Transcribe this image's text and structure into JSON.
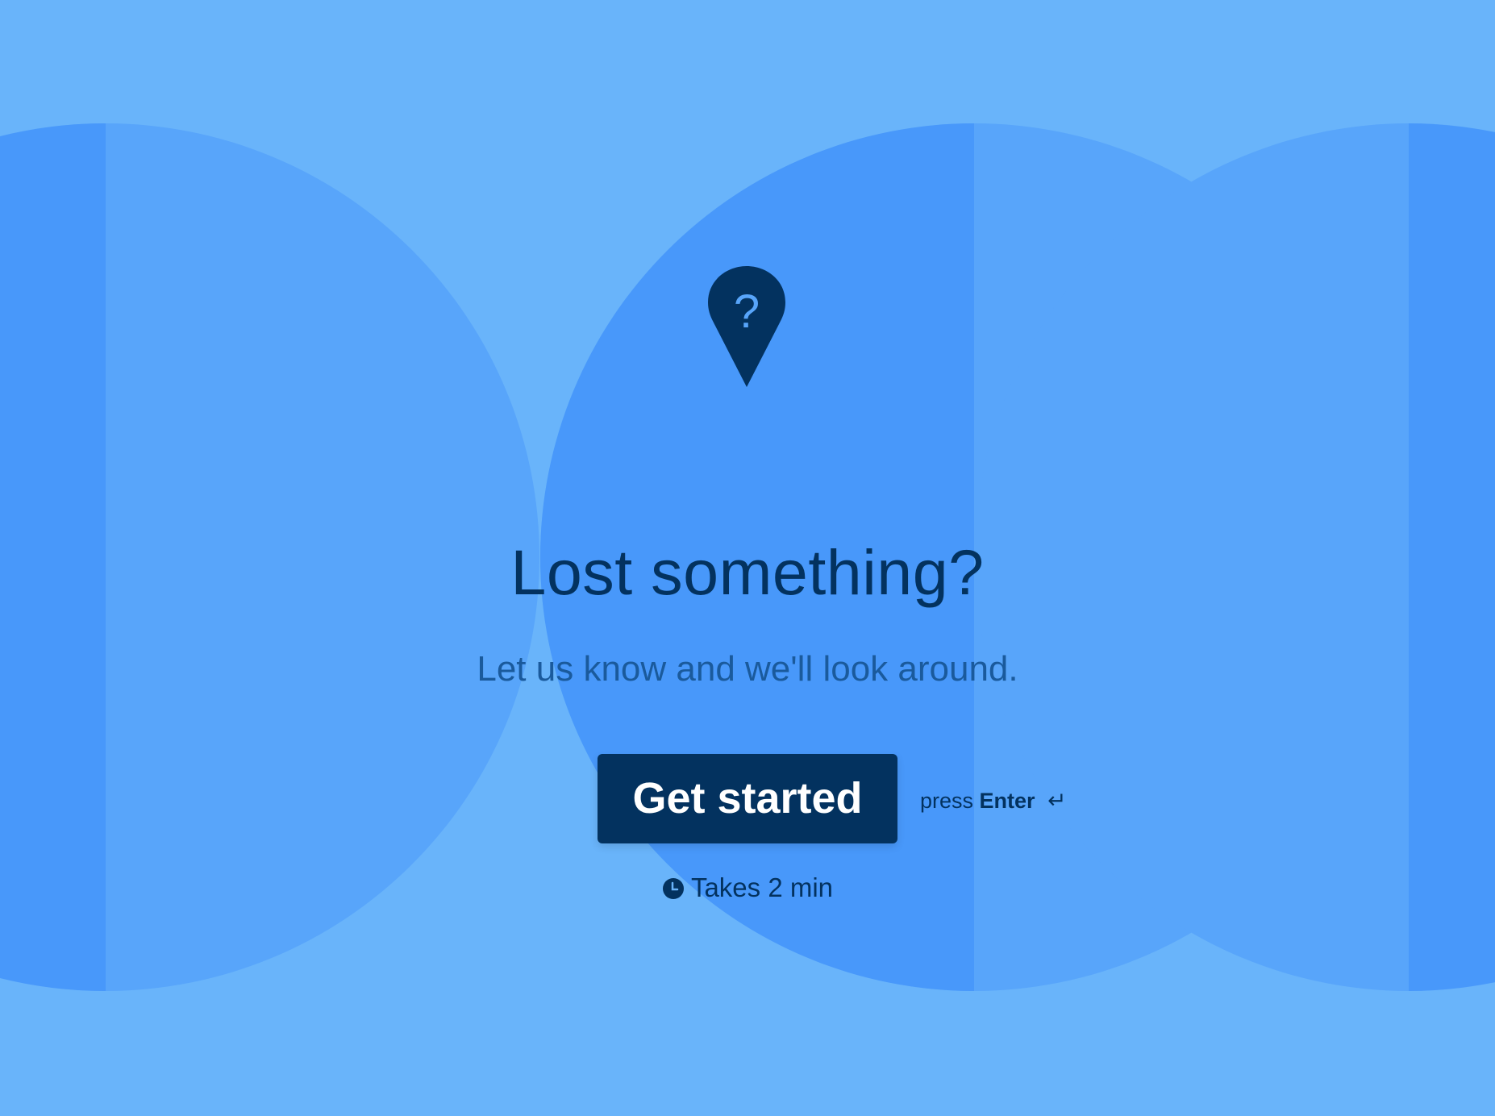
{
  "welcome": {
    "icon": "location-pin-question-icon",
    "headline": "Lost something?",
    "subtitle": "Let us know and we'll look around.",
    "start_button_label": "Get started",
    "hint_prefix": "press",
    "hint_key": "Enter",
    "hint_glyph": "↵",
    "duration_icon": "clock-icon",
    "duration_text": "Takes 2 min"
  },
  "colors": {
    "background": "#69b4fa",
    "shape_light": "#58a5fa",
    "shape_dark": "#4898fa",
    "primary": "#03325f",
    "subtitle": "#1a5a9c",
    "button_text": "#ffffff"
  }
}
